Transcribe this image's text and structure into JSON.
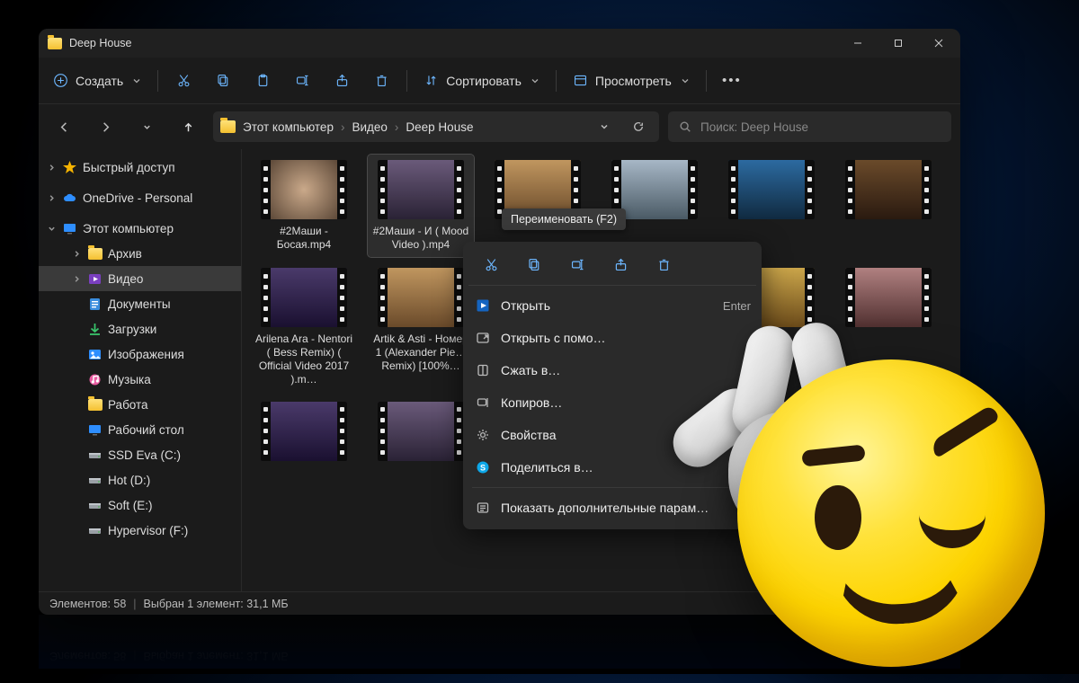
{
  "window": {
    "title": "Deep House"
  },
  "toolbar": {
    "new": "Создать",
    "sort": "Сортировать",
    "view": "Просмотреть"
  },
  "breadcrumb": [
    "Этот компьютер",
    "Видео",
    "Deep House"
  ],
  "search": {
    "placeholder": "Поиск: Deep House"
  },
  "sidebar": {
    "quick": "Быстрый доступ",
    "onedrive": "OneDrive - Personal",
    "thispc": "Этот компьютер",
    "items": [
      {
        "label": "Архив"
      },
      {
        "label": "Видео"
      },
      {
        "label": "Документы"
      },
      {
        "label": "Загрузки"
      },
      {
        "label": "Изображения"
      },
      {
        "label": "Музыка"
      },
      {
        "label": "Работа"
      },
      {
        "label": "Рабочий стол"
      },
      {
        "label": "SSD Eva (C:)"
      },
      {
        "label": "Hot (D:)"
      },
      {
        "label": "Soft (E:)"
      },
      {
        "label": "Hypervisor (F:)"
      }
    ]
  },
  "files": [
    {
      "name": "#2Маши - Босая.mp4"
    },
    {
      "name": "#2Маши - И ( Mood Video ).mp4"
    },
    {
      "name": ""
    },
    {
      "name": ""
    },
    {
      "name": ""
    },
    {
      "name": ""
    },
    {
      "name": "Arilena Ara - Nentori ( Bess Remix) ( Official Video 2017 ).m…"
    },
    {
      "name": "Artik & Asti - Номер 1 (Alexander Pie… Remix) [100%…"
    },
    {
      "name": ""
    },
    {
      "name": ""
    },
    {
      "name": ""
    },
    {
      "name": ""
    },
    {
      "name": ""
    },
    {
      "name": ""
    },
    {
      "name": ""
    },
    {
      "name": ""
    },
    {
      "name": ""
    },
    {
      "name": ""
    }
  ],
  "tooltip": "Переименовать (F2)",
  "context": {
    "open": "Открыть",
    "open_kbd": "Enter",
    "open_with": "Открыть с помо…",
    "compress": "Сжать в…",
    "copy_path": "Копиров…",
    "properties": "Свойства",
    "share_skype": "Поделиться в…",
    "more": "Показать дополнительные парам…"
  },
  "status": {
    "count": "Элементов: 58",
    "selection": "Выбран 1 элемент: 31,1 МБ"
  }
}
